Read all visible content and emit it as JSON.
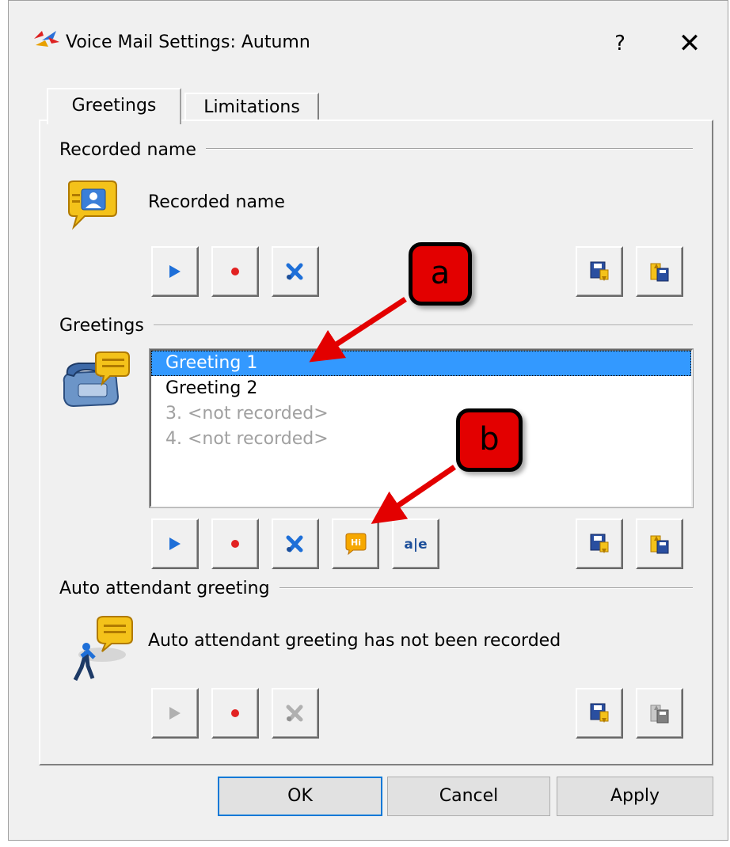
{
  "window": {
    "title": "Voice Mail Settings: Autumn",
    "help_label": "?",
    "close_label": "✕"
  },
  "tabs": [
    {
      "label": "Greetings",
      "selected": true
    },
    {
      "label": "Limitations",
      "selected": false
    }
  ],
  "recorded_name": {
    "section_label": "Recorded name",
    "status_text": "Recorded name"
  },
  "greetings": {
    "section_label": "Greetings",
    "items": [
      {
        "label": "Greeting 1",
        "state": "selected"
      },
      {
        "label": "Greeting 2",
        "state": "recorded"
      },
      {
        "label": "3. <not recorded>",
        "state": "not-recorded"
      },
      {
        "label": "4. <not recorded>",
        "state": "not-recorded"
      }
    ],
    "rename_icon_text": "a|e",
    "hi_icon_text": "Hi"
  },
  "auto_attendant": {
    "section_label": "Auto attendant greeting",
    "status_text": "Auto attendant greeting has not been recorded"
  },
  "buttons": {
    "ok": "OK",
    "cancel": "Cancel",
    "apply": "Apply"
  },
  "annotations": {
    "a": "a",
    "b": "b"
  },
  "colors": {
    "selection": "#3399ff",
    "callout": "#e30000",
    "arrow": "#e30000",
    "play": "#1e6fd8",
    "record": "#e22222"
  }
}
